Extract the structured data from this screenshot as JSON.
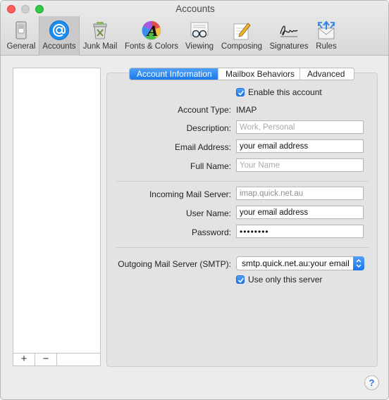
{
  "window": {
    "title": "Accounts"
  },
  "toolbar": {
    "items": [
      {
        "label": "General"
      },
      {
        "label": "Accounts"
      },
      {
        "label": "Junk Mail"
      },
      {
        "label": "Fonts & Colors"
      },
      {
        "label": "Viewing"
      },
      {
        "label": "Composing"
      },
      {
        "label": "Signatures"
      },
      {
        "label": "Rules"
      }
    ],
    "selected": "Accounts"
  },
  "account_list": {
    "add_label": "+",
    "remove_label": "−"
  },
  "tabs": [
    {
      "label": "Account Information",
      "active": true
    },
    {
      "label": "Mailbox Behaviors",
      "active": false
    },
    {
      "label": "Advanced",
      "active": false
    }
  ],
  "form": {
    "enable_account_label": "Enable this account",
    "account_type_label": "Account Type:",
    "account_type_value": "IMAP",
    "description_label": "Description:",
    "description_placeholder": "Work, Personal",
    "email_label": "Email Address:",
    "email_value": "your email address",
    "fullname_label": "Full Name:",
    "fullname_placeholder": "Your Name",
    "incoming_label": "Incoming Mail Server:",
    "incoming_value": "imap.quick.net.au",
    "username_label": "User Name:",
    "username_value": "your email address",
    "password_label": "Password:",
    "password_value": "••••••••",
    "outgoing_label": "Outgoing Mail Server (SMTP):",
    "outgoing_value": "smtp.quick.net.au:your email",
    "use_only_label": "Use only this server"
  },
  "help_label": "?",
  "colors": {
    "accent": "#1a78ea",
    "close": "#fc605c",
    "zoom": "#34c84a"
  }
}
